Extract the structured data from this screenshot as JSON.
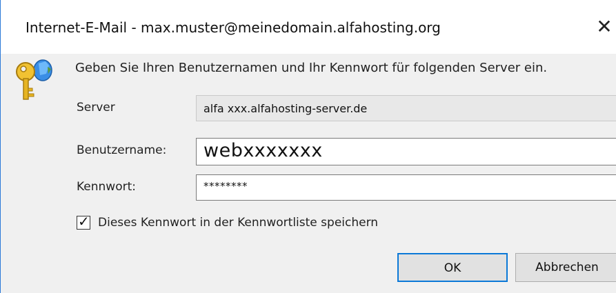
{
  "window": {
    "title": "Internet-E-Mail - max.muster@meinedomain.alfahosting.org",
    "close_glyph": "✕"
  },
  "prompt": "Geben Sie Ihren Benutzernamen und Ihr Kennwort für folgenden Server ein.",
  "icons": {
    "key": "key-icon",
    "close": "close-icon",
    "check": "checkmark-icon"
  },
  "form": {
    "server": {
      "label": "Server",
      "value": "alfa xxx.alfahosting-server.de"
    },
    "username": {
      "label": "Benutzername:",
      "value": "webxxxxxxx"
    },
    "password": {
      "label": "Kennwort:",
      "value": "********"
    },
    "remember": {
      "label": "Dieses Kennwort in der Kennwortliste speichern",
      "checked": true,
      "glyph": "✓"
    }
  },
  "buttons": {
    "ok": "OK",
    "cancel": "Abbrechen"
  },
  "colors": {
    "accent": "#0a78d7",
    "dialog_bg": "#f0f0f0",
    "titlebar_bg": "#ffffff"
  }
}
